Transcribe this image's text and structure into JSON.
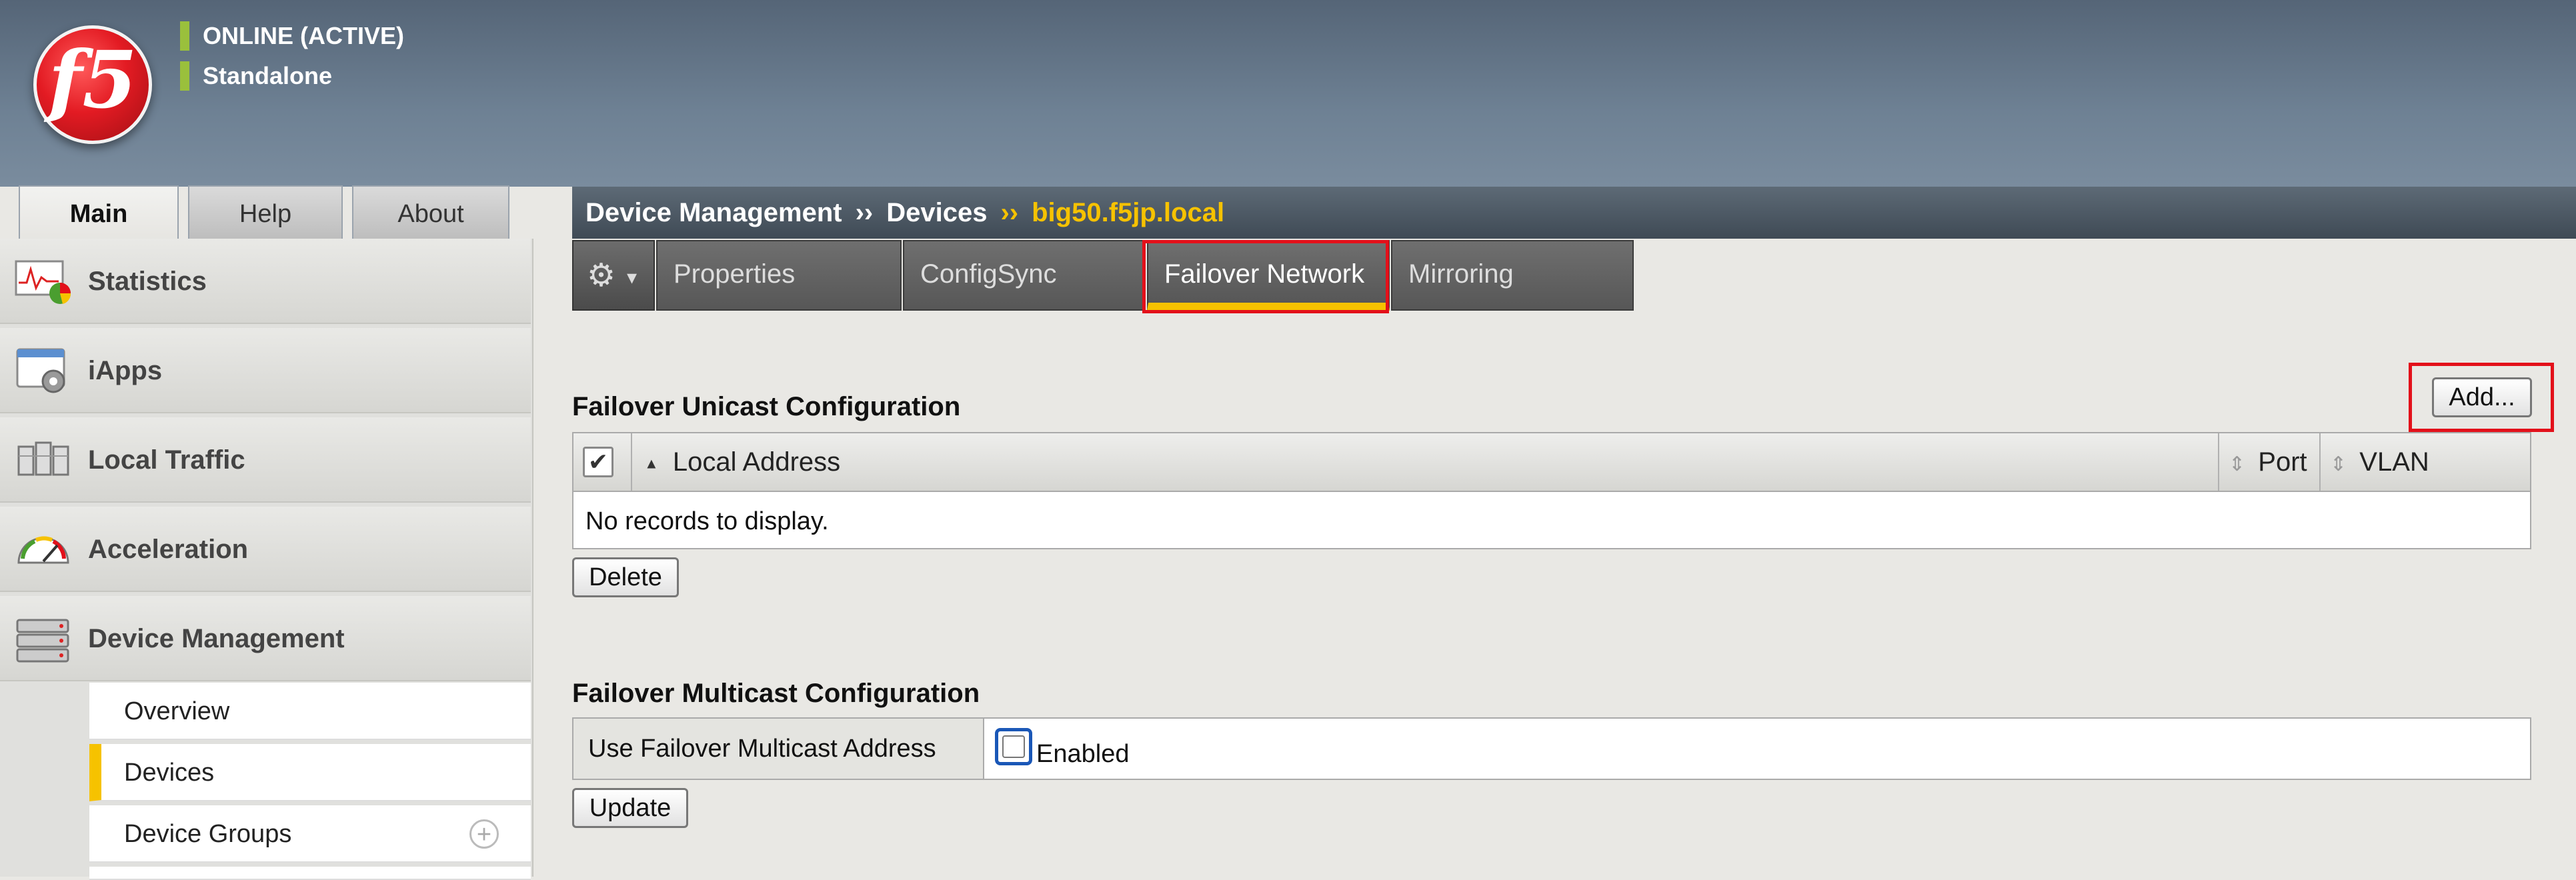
{
  "header": {
    "logo_text": "f5",
    "status_lines": [
      "ONLINE (ACTIVE)",
      "Standalone"
    ]
  },
  "main_tabs": [
    {
      "label": "Main",
      "active": true
    },
    {
      "label": "Help",
      "active": false
    },
    {
      "label": "About",
      "active": false
    }
  ],
  "sidebar": {
    "items": [
      {
        "label": "Statistics",
        "icon": "statistics-chart-icon"
      },
      {
        "label": "iApps",
        "icon": "iapps-window-icon"
      },
      {
        "label": "Local Traffic",
        "icon": "local-traffic-servers-icon"
      },
      {
        "label": "Acceleration",
        "icon": "speedometer-icon"
      },
      {
        "label": "Device Management",
        "icon": "device-stack-icon"
      }
    ],
    "subitems": [
      {
        "label": "Overview",
        "active": false
      },
      {
        "label": "Devices",
        "active": true
      },
      {
        "label": "Device Groups",
        "active": false,
        "has_add": true,
        "add_symbol": "+"
      }
    ]
  },
  "breadcrumb": {
    "items": [
      "Device Management",
      "Devices"
    ],
    "separator": "››",
    "current": "big50.f5jp.local"
  },
  "subtabs": {
    "gear_symbol": "⚙",
    "caret_symbol": "▾",
    "items": [
      {
        "label": "Properties",
        "active": false
      },
      {
        "label": "ConfigSync",
        "active": false
      },
      {
        "label": "Failover Network",
        "active": true
      },
      {
        "label": "Mirroring",
        "active": false
      }
    ]
  },
  "unicast": {
    "title": "Failover Unicast Configuration",
    "add_label": "Add...",
    "check_symbol": "✔",
    "sort_asc_symbol": "▲",
    "sort_symbol": "⇕",
    "columns": [
      "Local Address",
      "Port",
      "VLAN"
    ],
    "empty_message": "No records to display.",
    "delete_label": "Delete"
  },
  "multicast": {
    "title": "Failover Multicast Configuration",
    "label": "Use Failover Multicast Address",
    "checkbox_text": "Enabled",
    "checked": false,
    "update_label": "Update"
  },
  "colors": {
    "accent_yellow": "#f6c200",
    "highlight_red": "#e3101a",
    "status_green": "#9ac03c"
  }
}
